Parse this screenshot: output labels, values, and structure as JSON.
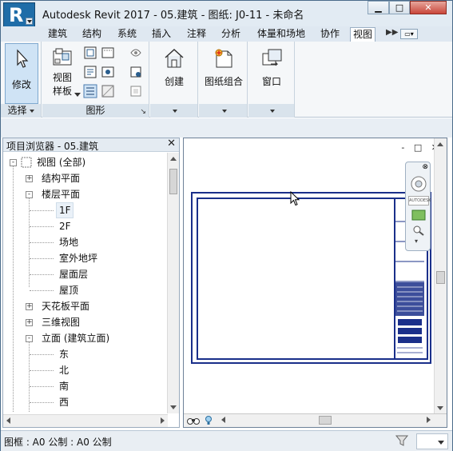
{
  "window": {
    "title": "Autodesk Revit 2017 -      05.建筑 - 图纸: J0-11 - 未命名",
    "app_button_letter": "R"
  },
  "ribbon": {
    "tabs": [
      {
        "label": "建筑"
      },
      {
        "label": "结构"
      },
      {
        "label": "系统"
      },
      {
        "label": "插入"
      },
      {
        "label": "注释"
      },
      {
        "label": "分析"
      },
      {
        "label": "体量和场地"
      },
      {
        "label": "协作"
      },
      {
        "label": "视图",
        "active": true
      }
    ],
    "panels": {
      "select": {
        "title": "选择",
        "modify_label": "修改"
      },
      "graphics": {
        "title": "图形",
        "view_template_label_1": "视图",
        "view_template_label_2": "样板"
      },
      "create": {
        "title": "",
        "button_label": "创建"
      },
      "sheet": {
        "title": "",
        "button_label": "图纸组合"
      },
      "window": {
        "title": "",
        "button_label": "窗口"
      }
    }
  },
  "project_browser": {
    "title": "项目浏览器 - 05.建筑",
    "tree": [
      {
        "label": "视图 (全部)",
        "level": 0,
        "toggle": "-"
      },
      {
        "label": "结构平面",
        "level": 1,
        "toggle": "+"
      },
      {
        "label": "楼层平面",
        "level": 1,
        "toggle": "-"
      },
      {
        "label": "1F",
        "level": 2,
        "toggle": "",
        "selected": true
      },
      {
        "label": "2F",
        "level": 2,
        "toggle": ""
      },
      {
        "label": "场地",
        "level": 2,
        "toggle": ""
      },
      {
        "label": "室外地坪",
        "level": 2,
        "toggle": ""
      },
      {
        "label": "屋面层",
        "level": 2,
        "toggle": ""
      },
      {
        "label": "屋顶",
        "level": 2,
        "toggle": ""
      },
      {
        "label": "天花板平面",
        "level": 1,
        "toggle": "+"
      },
      {
        "label": "三维视图",
        "level": 1,
        "toggle": "+"
      },
      {
        "label": "立面 (建筑立面)",
        "level": 1,
        "toggle": "-"
      },
      {
        "label": "东",
        "level": 2,
        "toggle": ""
      },
      {
        "label": "北",
        "level": 2,
        "toggle": ""
      },
      {
        "label": "南",
        "level": 2,
        "toggle": ""
      },
      {
        "label": "西",
        "level": 2,
        "toggle": ""
      }
    ]
  },
  "canvas": {
    "view_controls": "- □ ✕"
  },
  "statusbar": {
    "text": "图框 : A0 公制 : A0 公制"
  },
  "colors": {
    "sheet_border": "#1a2f8a",
    "ribbon_bg": "#f5f7f9",
    "title_bg": "#e2ebf3"
  }
}
